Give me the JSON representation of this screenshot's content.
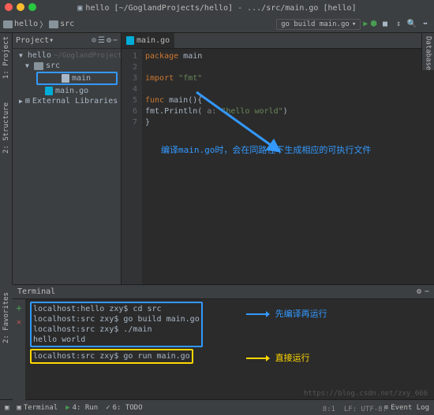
{
  "window": {
    "title": "hello [~/GoglandProjects/hello] - .../src/main.go [hello]"
  },
  "breadcrumb": {
    "p1": "hello",
    "p2": "src"
  },
  "run_config": {
    "label": "go build main.go"
  },
  "sidebar": {
    "project_label": "1: Project",
    "structure_label": "2: Structure",
    "database_label": "Database",
    "favorites_label": "2: Favorites"
  },
  "project_panel": {
    "title": "Project",
    "items": {
      "root": "hello",
      "root_path": "~/GoglandProjects/hel",
      "src": "src",
      "main": "main",
      "main_go": "main.go",
      "ext_lib": "External Libraries"
    }
  },
  "editor": {
    "tab": "main.go",
    "lines": [
      "1",
      "2",
      "3",
      "4",
      "5",
      "6",
      "7"
    ],
    "code": {
      "l1_kw": "package",
      "l1_id": " main",
      "l3_kw": "import",
      "l3_str": " \"fmt\"",
      "l5_kw": "func",
      "l5_id": " main(){",
      "l6": "    fmt.Println(",
      "l6_arg": " a: ",
      "l6_str": "\"hello world\"",
      "l6_end": ")",
      "l7": "}"
    },
    "callout": "编译main.go时，会在同路径下生成相应的可执行文件"
  },
  "terminal": {
    "title": "Terminal",
    "lines": {
      "l1": "localhost:hello zxy$ cd src",
      "l2": "localhost:src zxy$ go build main.go",
      "l3": "localhost:src zxy$ ./main",
      "l4": "hello world",
      "l5": "localhost:src zxy$ go run main.go"
    },
    "annot1": "先编译再运行",
    "annot2": "直接运行"
  },
  "status": {
    "terminal": "Terminal",
    "run": "4: Run",
    "todo": "6: TODO",
    "event_log": "Event Log",
    "pos": "8:1",
    "enc": "LF: UTF-8:"
  },
  "watermark": "https://blog.csdn.net/zxy_666"
}
